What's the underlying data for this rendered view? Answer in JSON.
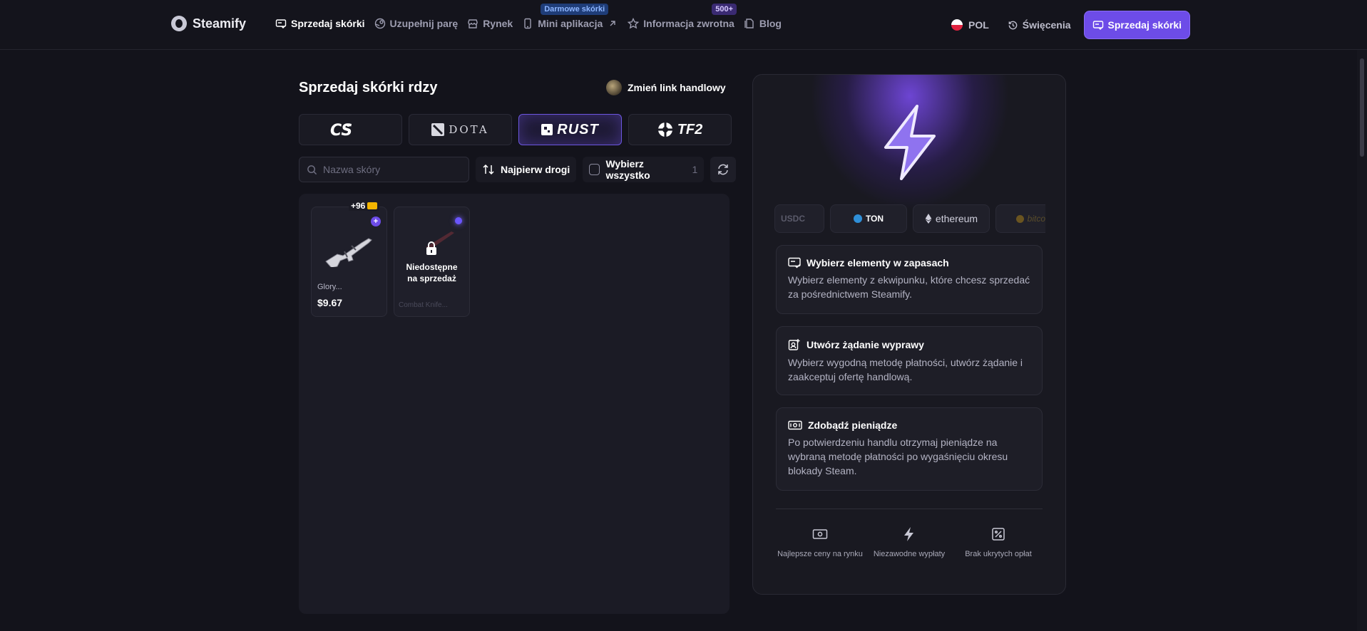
{
  "header": {
    "brand": "Steamify",
    "nav": [
      {
        "label": "Sprzedaj skórki",
        "icon": "sell-icon"
      },
      {
        "label": "Uzupełnij parę",
        "icon": "steam-icon"
      },
      {
        "label": "Rynek",
        "icon": "store-icon"
      },
      {
        "label": "Mini aplikacja",
        "icon": "phone-icon",
        "badge": "Darmowe skórki"
      },
      {
        "label": "Informacja zwrotna",
        "icon": "star-icon",
        "badge": "500+"
      },
      {
        "label": "Blog",
        "icon": "document-icon"
      }
    ],
    "language": "POL",
    "history": "Święcenia",
    "cta": "Sprzedaj skórki"
  },
  "main": {
    "title": "Sprzedaj skórki rdzy",
    "trade_link": "Zmień link handlowy",
    "games": [
      {
        "label": "CS",
        "name": "cs2"
      },
      {
        "label": "DOTA",
        "name": "dota"
      },
      {
        "label": "RUST",
        "name": "rust"
      },
      {
        "label": "TF2",
        "name": "tf2"
      }
    ],
    "search_placeholder": "Nazwa skóry",
    "sort_label": "Najpierw drogi",
    "select_all_label": "Wybierz wszystko",
    "select_count": "1",
    "items": [
      {
        "bonus": "+96",
        "name": "Glory...",
        "price": "$9.67"
      },
      {
        "unavailable": "Niedostępne na sprzedaż",
        "name": "Combat Knife..."
      }
    ]
  },
  "side": {
    "payments": [
      "USDC",
      "TON",
      "ethereum",
      "bitcoin"
    ],
    "steps": [
      {
        "title": "Wybierz elementy w zapasach",
        "text": "Wybierz elementy z ekwipunku, które chcesz sprzedać za pośrednictwem Steamify."
      },
      {
        "title": "Utwórz żądanie wyprawy",
        "text": "Wybierz wygodną metodę płatności, utwórz żądanie i zaakceptuj ofertę handlową."
      },
      {
        "title": "Zdobądź pieniądze",
        "text": "Po potwierdzeniu handlu otrzymaj pieniądze na wybraną metodę płatności po wygaśnięciu okresu blokady Steam."
      }
    ],
    "features": [
      "Najlepsze ceny na rynku",
      "Niezawodne wypłaty",
      "Brak ukrytych opłat"
    ]
  },
  "colors": {
    "accent": "#6d4ce8",
    "background": "#13131b"
  }
}
